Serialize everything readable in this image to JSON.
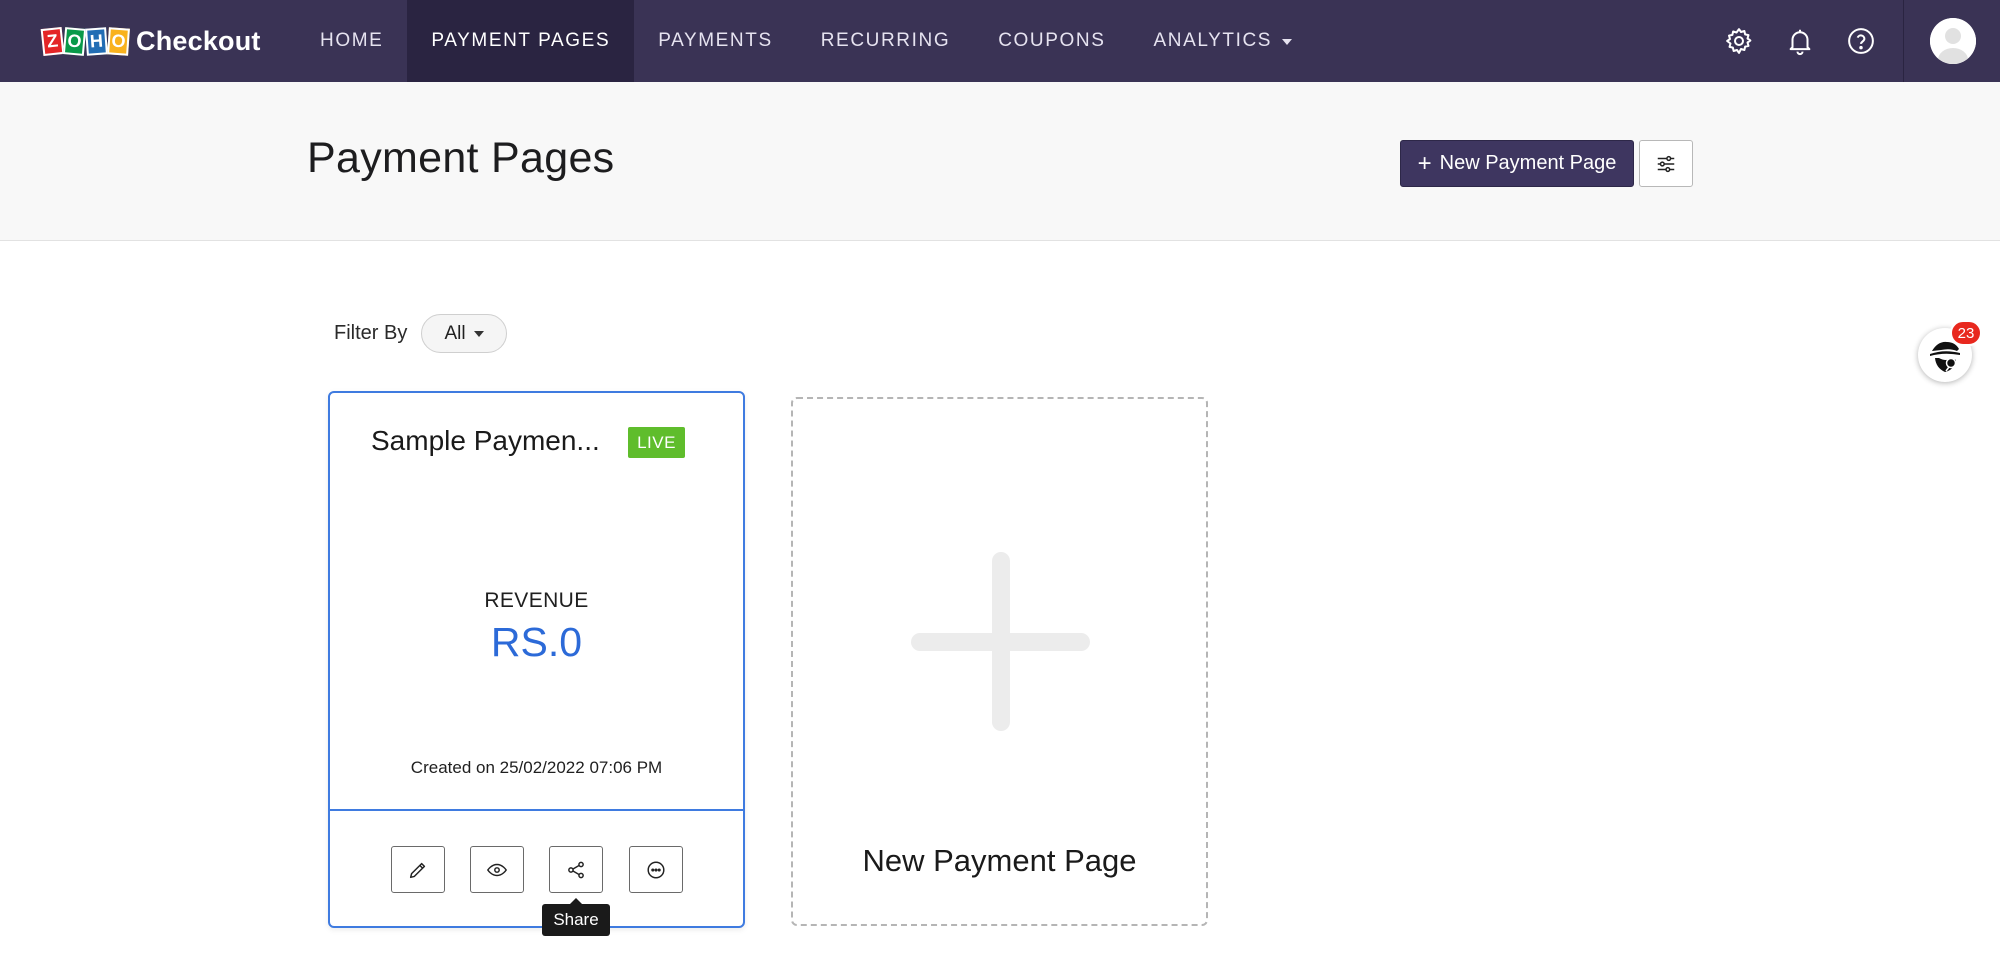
{
  "app": {
    "logo_letters": [
      "Z",
      "O",
      "H",
      "O"
    ],
    "name": "Checkout"
  },
  "nav": {
    "items": [
      {
        "label": "HOME"
      },
      {
        "label": "PAYMENT PAGES",
        "active": true
      },
      {
        "label": "PAYMENTS"
      },
      {
        "label": "RECURRING"
      },
      {
        "label": "COUPONS"
      },
      {
        "label": "ANALYTICS",
        "dropdown": true
      }
    ]
  },
  "top_icons": {
    "settings": "gear-icon",
    "notifications": "bell-icon",
    "help": "help-icon",
    "avatar": "user-avatar"
  },
  "page": {
    "title": "Payment Pages",
    "new_button_label": "New Payment Page",
    "settings_button_icon": "sliders-icon"
  },
  "filter": {
    "label": "Filter By",
    "value": "All"
  },
  "cards": [
    {
      "title": "Sample Paymen...",
      "status": "LIVE",
      "revenue_label": "REVENUE",
      "revenue_value": "RS.0",
      "created": "Created on 25/02/2022 07:06 PM",
      "actions": [
        "edit-icon",
        "eye-icon",
        "share-icon",
        "more-icon"
      ],
      "tooltip": "Share"
    }
  ],
  "new_card": {
    "label": "New Payment Page"
  },
  "helper": {
    "badge_count": "23"
  },
  "colors": {
    "topbar": "#3a3355",
    "primary_button": "#3e3660",
    "card_border": "#3f7be0",
    "live_badge": "#5fbd2c",
    "revenue_text": "#2c6ad8",
    "notification_badge": "#e8281e"
  }
}
